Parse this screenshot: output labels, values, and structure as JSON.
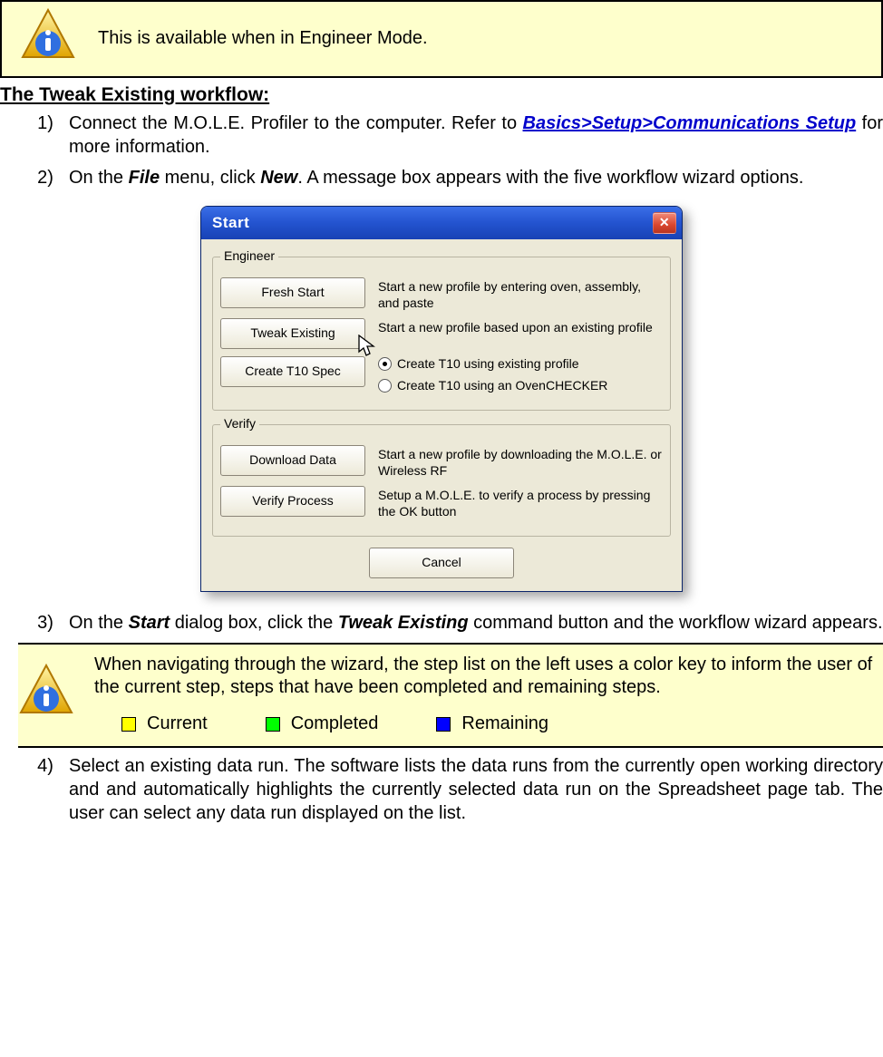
{
  "callout1": {
    "text": "This is available when in Engineer Mode."
  },
  "heading": "The Tweak Existing workflow:",
  "steps": {
    "s1a": "Connect the M.O.L.E. Profiler to the computer. Refer to ",
    "s1_link": "Basics>Setup>Communications Setup",
    "s1b": " for more information.",
    "s2a": "On the ",
    "s2_file": "File",
    "s2b": " menu, click ",
    "s2_new": "New",
    "s2c": ". A message box appears with the five workflow wizard options.",
    "s3a": "On the ",
    "s3_start": "Start",
    "s3b": " dialog box, click the ",
    "s3_tweak": "Tweak Existing",
    "s3c": " command button and the workflow wizard appears.",
    "s4": "Select an existing data run. The software lists the data runs from the currently open working directory and and automatically highlights the currently selected data run on the Spreadsheet page tab. The user can select any data run displayed on the list."
  },
  "dialog": {
    "title": "Start",
    "groups": {
      "engineer": "Engineer",
      "verify": "Verify"
    },
    "buttons": {
      "fresh": "Fresh Start",
      "tweak": "Tweak Existing",
      "t10": "Create T10 Spec",
      "download": "Download Data",
      "verify": "Verify Process",
      "cancel": "Cancel"
    },
    "descs": {
      "fresh": "Start a new profile by entering oven, assembly, and paste",
      "tweak": "Start a new profile based upon an existing profile",
      "download": "Start a new profile by downloading the M.O.L.E. or Wireless RF",
      "verify": "Setup a M.O.L.E. to verify a process by pressing the OK button"
    },
    "radios": {
      "r1": "Create T10 using existing profile",
      "r2": "Create T10 using an OvenCHECKER"
    }
  },
  "callout2": {
    "text": "When navigating through the wizard, the step list on the left uses a color key to inform the user of the current step, steps that have been completed and remaining steps.",
    "legend": {
      "current": "Current",
      "completed": "Completed",
      "remaining": "Remaining"
    }
  }
}
